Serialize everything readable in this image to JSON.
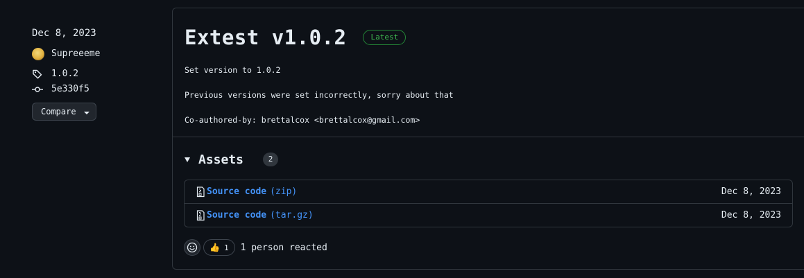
{
  "meta": {
    "date": "Dec 8, 2023",
    "author": "Supreeeme",
    "tag": "1.0.2",
    "commit": "5e330f5",
    "compare_label": "Compare"
  },
  "release": {
    "title": "Extest v1.0.2",
    "badge": "Latest",
    "notes": [
      "Set version to 1.0.2",
      "Previous versions were set incorrectly, sorry about that",
      "Co-authored-by: brettalcox <brettalcox@gmail.com>"
    ]
  },
  "assets": {
    "title": "Assets",
    "count": "2",
    "items": [
      {
        "name": "Source code",
        "ext": "(zip)",
        "date": "Dec 8, 2023"
      },
      {
        "name": "Source code",
        "ext": "(tar.gz)",
        "date": "Dec 8, 2023"
      }
    ]
  },
  "reactions": {
    "emoji": "👍",
    "count": "1",
    "summary": "1 person reacted"
  },
  "colors": {
    "background": "#0d1117",
    "border": "#30363d",
    "link": "#4493f8",
    "latest_green": "#3fb950"
  }
}
